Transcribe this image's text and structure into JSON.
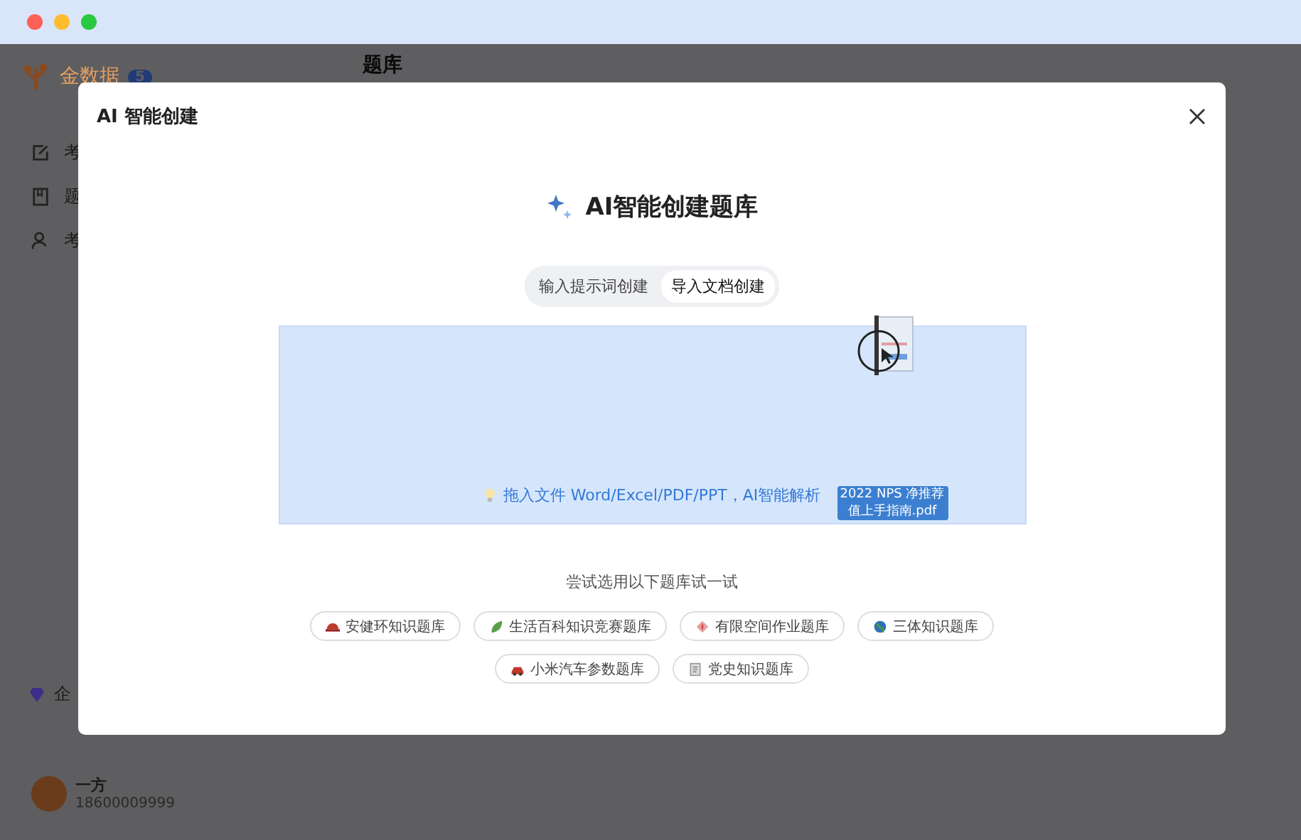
{
  "app": {
    "logo_text": "金数据",
    "badge": "5",
    "header": "题库",
    "nav_items": [
      {
        "label": "考",
        "kind": "edit"
      },
      {
        "label": "题",
        "kind": "book"
      },
      {
        "label": "考",
        "kind": "person"
      }
    ],
    "plan": {
      "label": "企"
    },
    "user": {
      "name": "一方",
      "phone": "18600009999"
    }
  },
  "dialog": {
    "title": "AI 智能创建",
    "heading": "AI智能创建题库",
    "tabs": [
      {
        "label": "输入提示词创建",
        "selected": false
      },
      {
        "label": "导入文档创建",
        "selected": true
      }
    ],
    "dropzone": {
      "hint": "拖入文件 Word/Excel/PDF/PPT，AI智能解析",
      "dragged_file": "2022 NPS 净推荐值上手指南.pdf"
    },
    "suggestion_title": "尝试选用以下题库试一试",
    "suggestions": [
      {
        "label": "安健环知识题库",
        "kind": "helmet"
      },
      {
        "label": "生活百科知识竞赛题库",
        "kind": "leaf"
      },
      {
        "label": "有限空间作业题库",
        "kind": "sign"
      },
      {
        "label": "三体知识题库",
        "kind": "globe"
      },
      {
        "label": "小米汽车参数题库",
        "kind": "car"
      },
      {
        "label": "党史知识题库",
        "kind": "doc"
      }
    ]
  }
}
